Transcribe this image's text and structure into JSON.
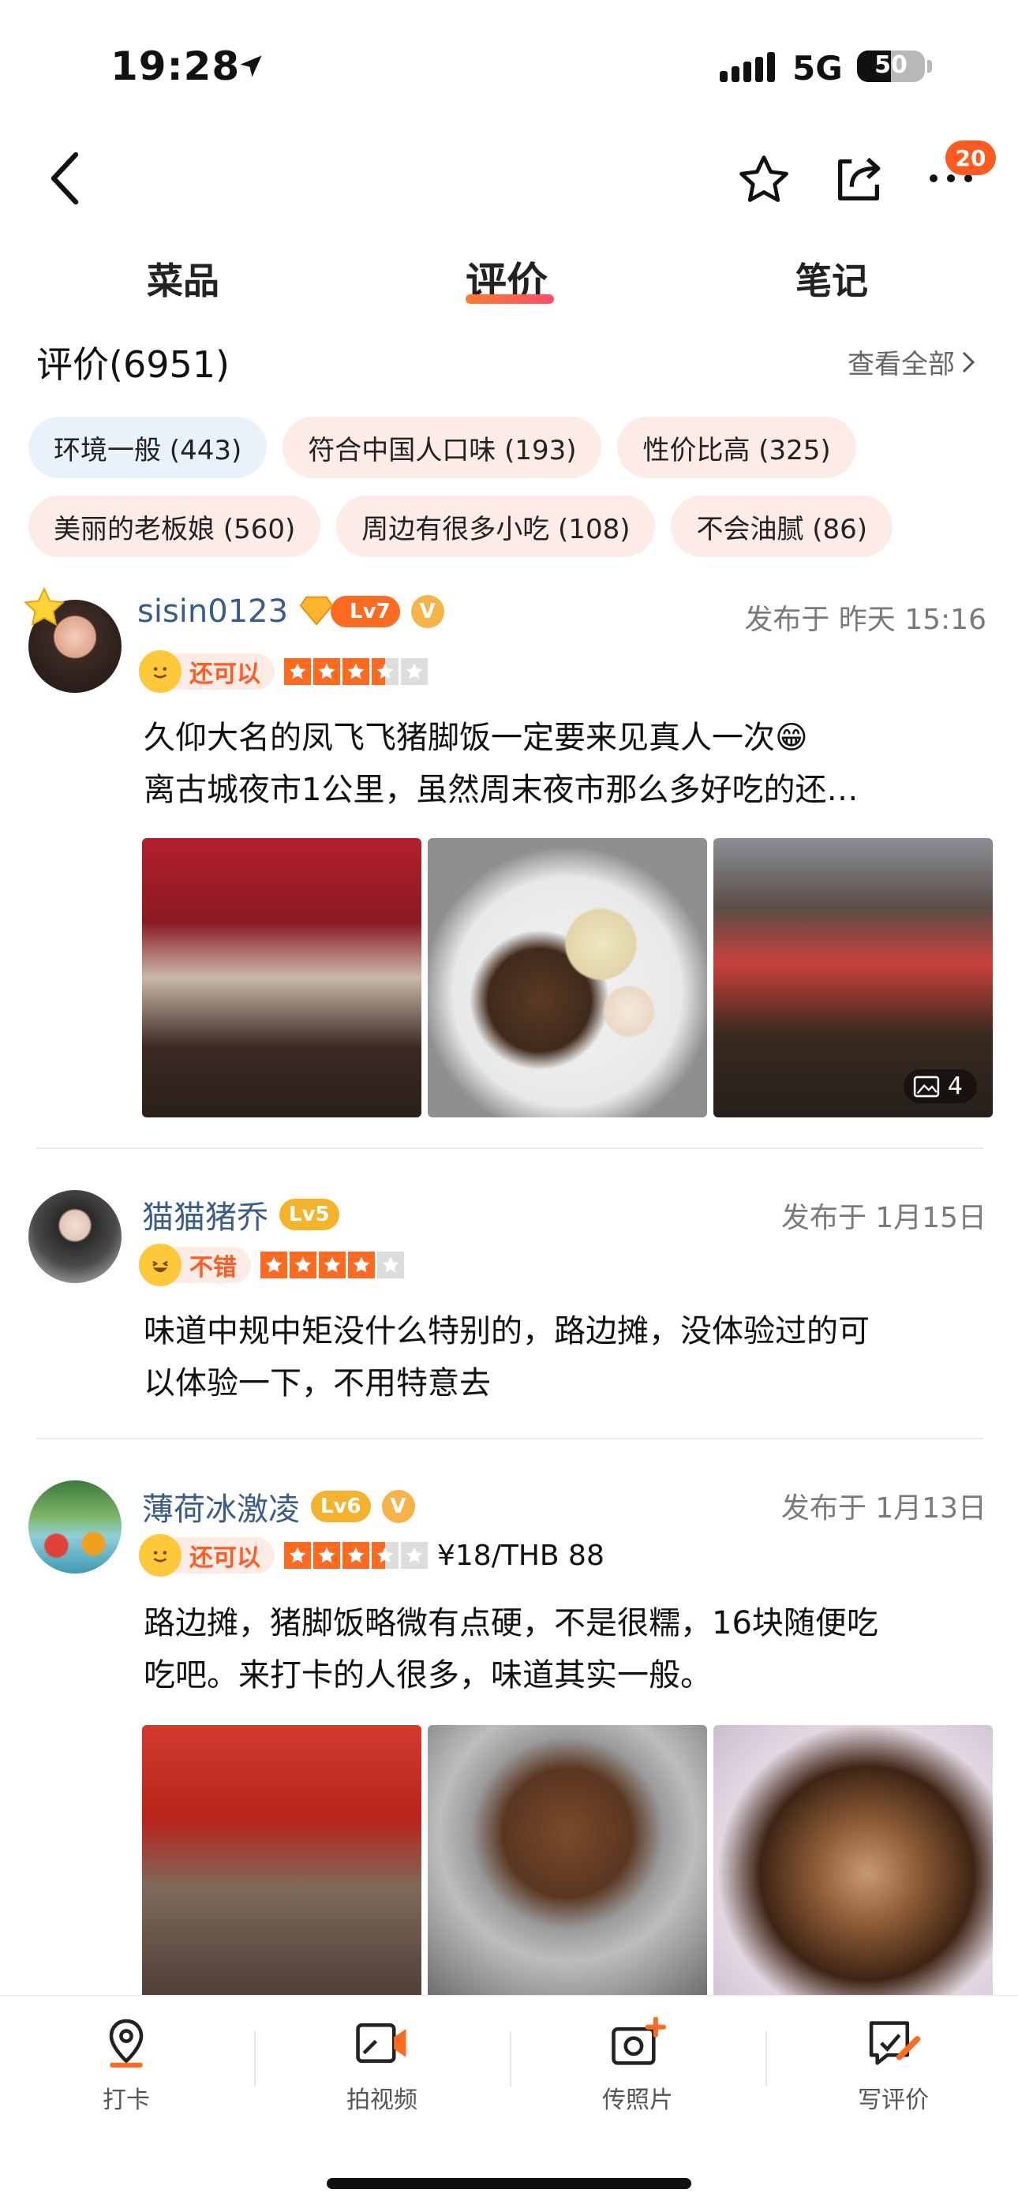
{
  "status_bar": {
    "time": "19:28",
    "network": "5G",
    "battery": "50",
    "battery_level": 0.5
  },
  "nav": {
    "more_badge": "20"
  },
  "tabs": [
    {
      "label": "菜品",
      "active": false
    },
    {
      "label": "评价",
      "active": true
    },
    {
      "label": "笔记",
      "active": false
    }
  ],
  "reviews_header": {
    "title": "评价(6951)",
    "view_all": "查看全部"
  },
  "tags": [
    {
      "label": "环境一般 (443)",
      "tone": "neutral"
    },
    {
      "label": "符合中国人口味 (193)",
      "tone": "positive"
    },
    {
      "label": "性价比高 (325)",
      "tone": "positive"
    },
    {
      "label": "美丽的老板娘 (560)",
      "tone": "positive"
    },
    {
      "label": "周边有很多小吃 (108)",
      "tone": "positive"
    },
    {
      "label": "不会油腻 (86)",
      "tone": "positive"
    }
  ],
  "reviews": [
    {
      "username": "sisin0123",
      "level": "Lv7",
      "verified": "V",
      "published": "发布于 昨天 15:16",
      "mood": "还可以",
      "rating": 3.5,
      "price": "",
      "text_line1": "久仰大名的凤飞飞猪脚饭一定要来见真人一次😁",
      "text_line2": "离古城夜市1公里，虽然周末夜市那么多好吃的还…",
      "image_count": "4"
    },
    {
      "username": "猫猫猪乔",
      "level": "Lv5",
      "verified": "",
      "published": "发布于 1月15日",
      "mood": "不错",
      "rating": 4,
      "price": "",
      "text_line1": "味道中规中矩没什么特别的，路边摊，没体验过的可",
      "text_line2": "以体验一下，不用特意去",
      "image_count": ""
    },
    {
      "username": "薄荷冰激凌",
      "level": "Lv6",
      "verified": "V",
      "published": "发布于 1月13日",
      "mood": "还可以",
      "rating": 3.5,
      "price": "¥18/THB 88",
      "text_line1": "路边摊，猪脚饭略微有点硬，不是很糯，16块随便吃",
      "text_line2": "吃吧。来打卡的人很多，味道其实一般。",
      "image_count": ""
    }
  ],
  "toolbar": [
    {
      "label": "打卡",
      "icon": "location-pin-icon"
    },
    {
      "label": "拍视频",
      "icon": "video-camera-icon"
    },
    {
      "label": "传照片",
      "icon": "photo-upload-icon"
    },
    {
      "label": "写评价",
      "icon": "write-review-icon"
    }
  ],
  "colors": {
    "accent": "#ff5b23",
    "username": "#3a5c8a",
    "tag_bg": "#fdebe7",
    "tag_neutral_bg": "#e9f2fb"
  }
}
